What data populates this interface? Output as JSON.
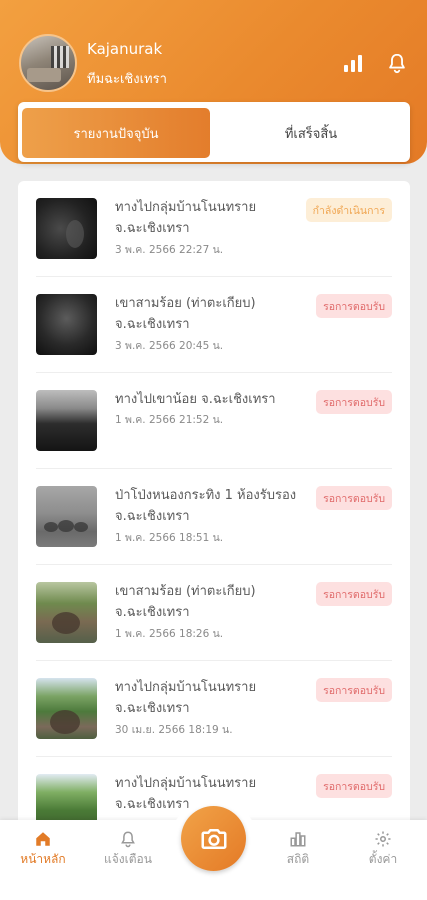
{
  "header": {
    "username": "Kajanurak",
    "team": "ทีมฉะเชิงเทรา",
    "icons": [
      "signal-icon",
      "bell-icon"
    ]
  },
  "tabs": {
    "current": "รายงานปัจจุบัน",
    "done": "ที่เสร็จสิ้น"
  },
  "reports": [
    {
      "title": "ทางไปกลุ่มบ้านโนนทราย จ.ฉะเชิงเทรา",
      "date": "3 พ.ค. 2566 22:27 น.",
      "status": "กำลังดำเนินการ",
      "status_type": "progress"
    },
    {
      "title": "เขาสามร้อย (ท่าตะเกียบ) จ.ฉะเชิงเทรา",
      "date": "3 พ.ค. 2566 20:45 น.",
      "status": "รอการตอบรับ",
      "status_type": "pending"
    },
    {
      "title": "ทางไปเขาน้อย จ.ฉะเชิงเทรา",
      "date": "1 พ.ค. 2566 21:52 น.",
      "status": "รอการตอบรับ",
      "status_type": "pending"
    },
    {
      "title": "ป่าโป่งหนองกระทิง 1 ห้องรับรอง จ.ฉะเชิงเทรา",
      "date": "1 พ.ค. 2566 18:51 น.",
      "status": "รอการตอบรับ",
      "status_type": "pending"
    },
    {
      "title": "เขาสามร้อย (ท่าตะเกียบ) จ.ฉะเชิงเทรา",
      "date": "1 พ.ค. 2566 18:26 น.",
      "status": "รอการตอบรับ",
      "status_type": "pending"
    },
    {
      "title": "ทางไปกลุ่มบ้านโนนทราย จ.ฉะเชิงเทรา",
      "date": "30 เม.ย. 2566 18:19 น.",
      "status": "รอการตอบรับ",
      "status_type": "pending"
    },
    {
      "title": "ทางไปกลุ่มบ้านโนนทราย จ.ฉะเชิงเทรา",
      "date": "",
      "status": "รอการตอบรับ",
      "status_type": "pending"
    }
  ],
  "nav": {
    "home": "หน้าหลัก",
    "alerts": "แจ้งเตือน",
    "stats": "สถิติ",
    "settings": "ตั้งค่า"
  },
  "colors": {
    "accent": "#e27b27",
    "pending_bg": "#fde0e0",
    "pending_text": "#e06a6a",
    "progress_bg": "#fdeed7",
    "progress_text": "#f0a754"
  }
}
